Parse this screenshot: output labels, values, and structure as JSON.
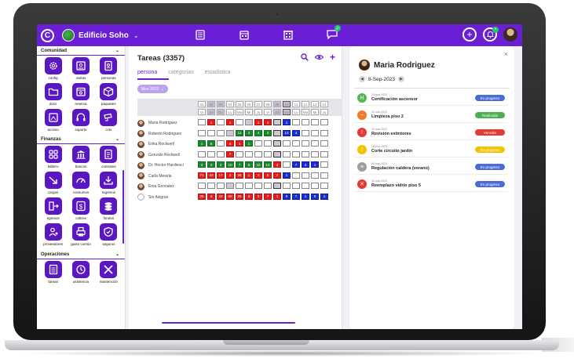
{
  "header": {
    "logo_letter": "C",
    "site_name": "Edificio Soho",
    "site_chevron": "⌄",
    "nav_icons": [
      "tasks-list-icon",
      "calendar-icon",
      "building-icon",
      "chat-icon"
    ],
    "chat_badge": "✓",
    "add_label": "+",
    "notifications_badge": "•"
  },
  "sidebar": {
    "sections": [
      {
        "label": "Comunidad",
        "items": [
          "config",
          "visitas",
          "personas",
          "docs",
          "reserva",
          "paquetes",
          "acceso",
          "soporte",
          "cctv"
        ]
      },
      {
        "label": "Finanzas",
        "items": [
          "tablero",
          "bancos",
          "contratos",
          "cargos",
          "consumos",
          "Ingresos",
          "egresos",
          "cobros",
          "fondos",
          "proveedores",
          "gasto común",
          "seguros"
        ]
      },
      {
        "label": "Operaciones",
        "items": [
          "tareas",
          "asistencia",
          "mantención"
        ]
      }
    ],
    "toggle": "⌄"
  },
  "tasks": {
    "title": "Tareas (3357)",
    "tabs": [
      "persona",
      "categorias",
      "estadistica"
    ],
    "active_tab": "persona",
    "month_filter": "Mes 2023",
    "day_numbers": [
      "01",
      "02",
      "03",
      "04",
      "05",
      "06",
      "07",
      "08",
      "09",
      "10",
      "11",
      "12",
      "13",
      "14"
    ],
    "day_names": [
      "Vi",
      "Sá",
      "Do",
      "Lu",
      "Ma",
      "Mi",
      "Ju",
      "Vi",
      "Sá",
      "Do",
      "Lu",
      "Ma",
      "Mi",
      "Ju"
    ],
    "people": [
      {
        "name": "Maria Rodriguez",
        "cells": [
          "",
          "r:1",
          "",
          "r:1",
          "",
          "s:",
          "r:2",
          "r:4",
          "cur:",
          "b:1",
          "",
          "",
          "",
          ""
        ]
      },
      {
        "name": "Roberto Rodriguez",
        "cells": [
          "",
          "",
          "",
          "s:",
          "g:11",
          "g:3",
          "g:4",
          "g:3",
          "cur:",
          "b:13",
          "b:4",
          "",
          "",
          ""
        ]
      },
      {
        "name": "Erika Rockwell",
        "cells": [
          "g:1",
          "g:8",
          "",
          "r:4",
          "r:3",
          "g:1",
          "",
          "",
          "cur:",
          "",
          "",
          "",
          "",
          ""
        ]
      },
      {
        "name": "Gonzalo Rockwell",
        "cells": [
          "",
          "",
          "",
          "r:7",
          "",
          "",
          "",
          "",
          "cur:",
          "",
          "",
          "",
          "",
          ""
        ]
      },
      {
        "name": "Dr. Hector Hardiesci",
        "cells": [
          "g:2",
          "g:3",
          "g:3",
          "g:10",
          "g:7",
          "g:8",
          "g:10",
          "g:14",
          "r:3",
          "",
          "b:7",
          "b:4",
          "b:1",
          ""
        ]
      },
      {
        "name": "Carla Mesela",
        "cells": [
          "r:71",
          "r:23",
          "r:17",
          "r:3",
          "r:26",
          "r:1",
          "r:1",
          "r:5",
          "r:2",
          "b:1",
          "",
          "",
          "",
          ""
        ]
      },
      {
        "name": "Ema Gonzalez",
        "cells": [
          "",
          "",
          "",
          "s:",
          "",
          "",
          "",
          "",
          "cur:",
          "",
          "",
          "",
          "",
          ""
        ]
      },
      {
        "name": "Sin Asignar",
        "cells": [
          "r:26",
          "r:4",
          "r:43",
          "r:60",
          "r:25",
          "r:3",
          "r:2",
          "r:7",
          "r:1",
          "b:9",
          "b:7",
          "b:1",
          "b:8",
          "b:1"
        ]
      }
    ]
  },
  "detail": {
    "close": "×",
    "name": "Maria Rodriguez",
    "date": "8-Sep-2023",
    "tasks": [
      {
        "date": "20-mar-2023",
        "name": "Certificación ascensor",
        "status": "En progreso",
        "color": "#4d6bd8",
        "icon_color": "#53b94b",
        "icon": "H"
      },
      {
        "date": "20-mar-2023",
        "name": "Limpieza piso 2",
        "status": "Realizada",
        "color": "#4caf50",
        "icon_color": "#f07a2c",
        "icon": "~"
      },
      {
        "date": "20-mar-2023",
        "name": "Revisión extintores",
        "status": "Vencido",
        "color": "#e53935",
        "icon_color": "#e53935",
        "icon": "!"
      },
      {
        "date": "18-mar-2023",
        "name": "Corte circuito jardín",
        "status": "En progreso",
        "color": "#f5c400",
        "icon_color": "#f5c400",
        "icon": "!"
      },
      {
        "date": "20-mar-2023",
        "name": "Regulación caldera (verano)",
        "status": "En progreso",
        "color": "#4d6bd8",
        "icon_color": "#9e9e9e",
        "icon": "≡"
      },
      {
        "date": "20-mar-2023",
        "name": "Reemplazo vidrio piso 5",
        "status": "En progreso",
        "color": "#4d6bd8",
        "icon_color": "#e53935",
        "icon": "✕"
      }
    ]
  }
}
